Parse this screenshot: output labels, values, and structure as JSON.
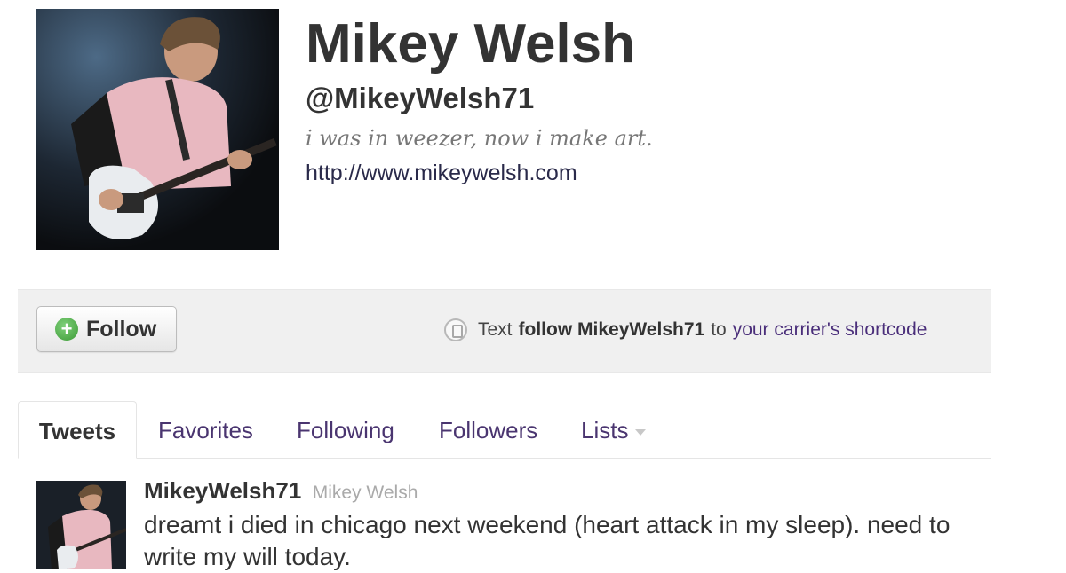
{
  "profile": {
    "display_name": "Mikey Welsh",
    "handle": "@MikeyWelsh71",
    "bio": "i was in weezer, now i make art.",
    "website": "http://www.mikeywelsh.com",
    "avatar_icon": "profile-photo"
  },
  "follow_bar": {
    "follow_label": "Follow",
    "follow_icon": "plus-circle-icon",
    "sms_icon": "phone-icon",
    "sms_text_prefix": "Text",
    "sms_command": "follow MikeyWelsh71",
    "sms_to": "to",
    "sms_link": "your carrier's shortcode"
  },
  "tabs": [
    {
      "label": "Tweets",
      "active": true
    },
    {
      "label": "Favorites"
    },
    {
      "label": "Following"
    },
    {
      "label": "Followers"
    },
    {
      "label": "Lists"
    }
  ],
  "tweet": {
    "handle": "MikeyWelsh71",
    "name": "Mikey Welsh",
    "text": "dreamt i died in chicago next weekend (heart attack in my sleep). need to write my will today."
  },
  "colors": {
    "link": "#4a2e7a",
    "follow_green": "#3c9a36",
    "bar_background": "#f0f0f0"
  }
}
